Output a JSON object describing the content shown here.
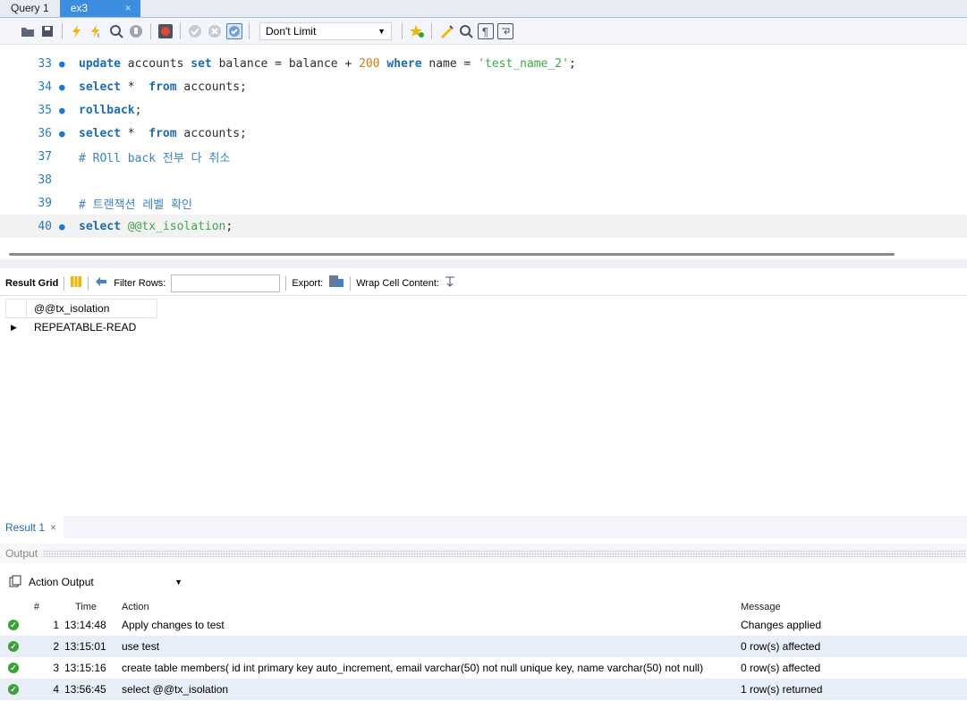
{
  "tabs": [
    {
      "label": "Query 1"
    },
    {
      "label": "ex3",
      "close": "×"
    }
  ],
  "toolbar": {
    "limit_value": "Don't Limit"
  },
  "editor": {
    "lines": [
      {
        "no": "33",
        "parts": [
          [
            "kw",
            "update"
          ],
          [
            "",
            "accounts"
          ],
          [
            "kw",
            "set"
          ],
          [
            "",
            "balance = balance +"
          ],
          [
            "num",
            "200"
          ],
          [
            "kw",
            "where"
          ],
          [
            "",
            "name ="
          ],
          [
            "str",
            "'test_name_2'"
          ],
          [
            "",
            ";"
          ]
        ]
      },
      {
        "no": "34",
        "parts": [
          [
            "kw",
            "select"
          ],
          [
            "",
            "* "
          ],
          [
            "kw",
            "from"
          ],
          [
            "",
            "accounts;"
          ]
        ]
      },
      {
        "no": "35",
        "parts": [
          [
            "kw",
            "rollback"
          ],
          [
            "",
            ";"
          ]
        ]
      },
      {
        "no": "36",
        "parts": [
          [
            "kw",
            "select"
          ],
          [
            "",
            "* "
          ],
          [
            "kw",
            "from"
          ],
          [
            "",
            "accounts;"
          ]
        ]
      },
      {
        "no": "37",
        "parts": [
          [
            "cmt",
            "# ROll back 전부 다 취소"
          ]
        ]
      },
      {
        "no": "38",
        "parts": []
      },
      {
        "no": "39",
        "parts": [
          [
            "cmt",
            "# 트랜잭션 레벨 확인"
          ]
        ]
      },
      {
        "no": "40",
        "parts": [
          [
            "kw",
            "select"
          ],
          [
            "var",
            "@@tx_isolation"
          ],
          [
            "",
            ";"
          ]
        ]
      }
    ]
  },
  "result_toolbar": {
    "result_grid": "Result Grid",
    "filter_rows": "Filter Rows:",
    "export": "Export:",
    "wrap": "Wrap Cell Content:"
  },
  "grid": {
    "column": "@@tx_isolation",
    "value": "REPEATABLE-READ"
  },
  "result_tab": {
    "label": "Result 1",
    "close": "×"
  },
  "output": {
    "title": "Output",
    "selector": "Action Output",
    "headers": {
      "num": "#",
      "time": "Time",
      "action": "Action",
      "message": "Message"
    },
    "rows": [
      {
        "num": "1",
        "time": "13:14:48",
        "action": "Apply changes to test",
        "message": "Changes applied"
      },
      {
        "num": "2",
        "time": "13:15:01",
        "action": "use test",
        "message": "0 row(s) affected"
      },
      {
        "num": "3",
        "time": "13:15:16",
        "action": "create table members( id int primary key auto_increment,      email varchar(50) not null unique key,      name varchar(50) not null)",
        "message": "0 row(s) affected"
      },
      {
        "num": "4",
        "time": "13:56:45",
        "action": "select @@tx_isolation",
        "message": "1 row(s) returned"
      }
    ]
  }
}
